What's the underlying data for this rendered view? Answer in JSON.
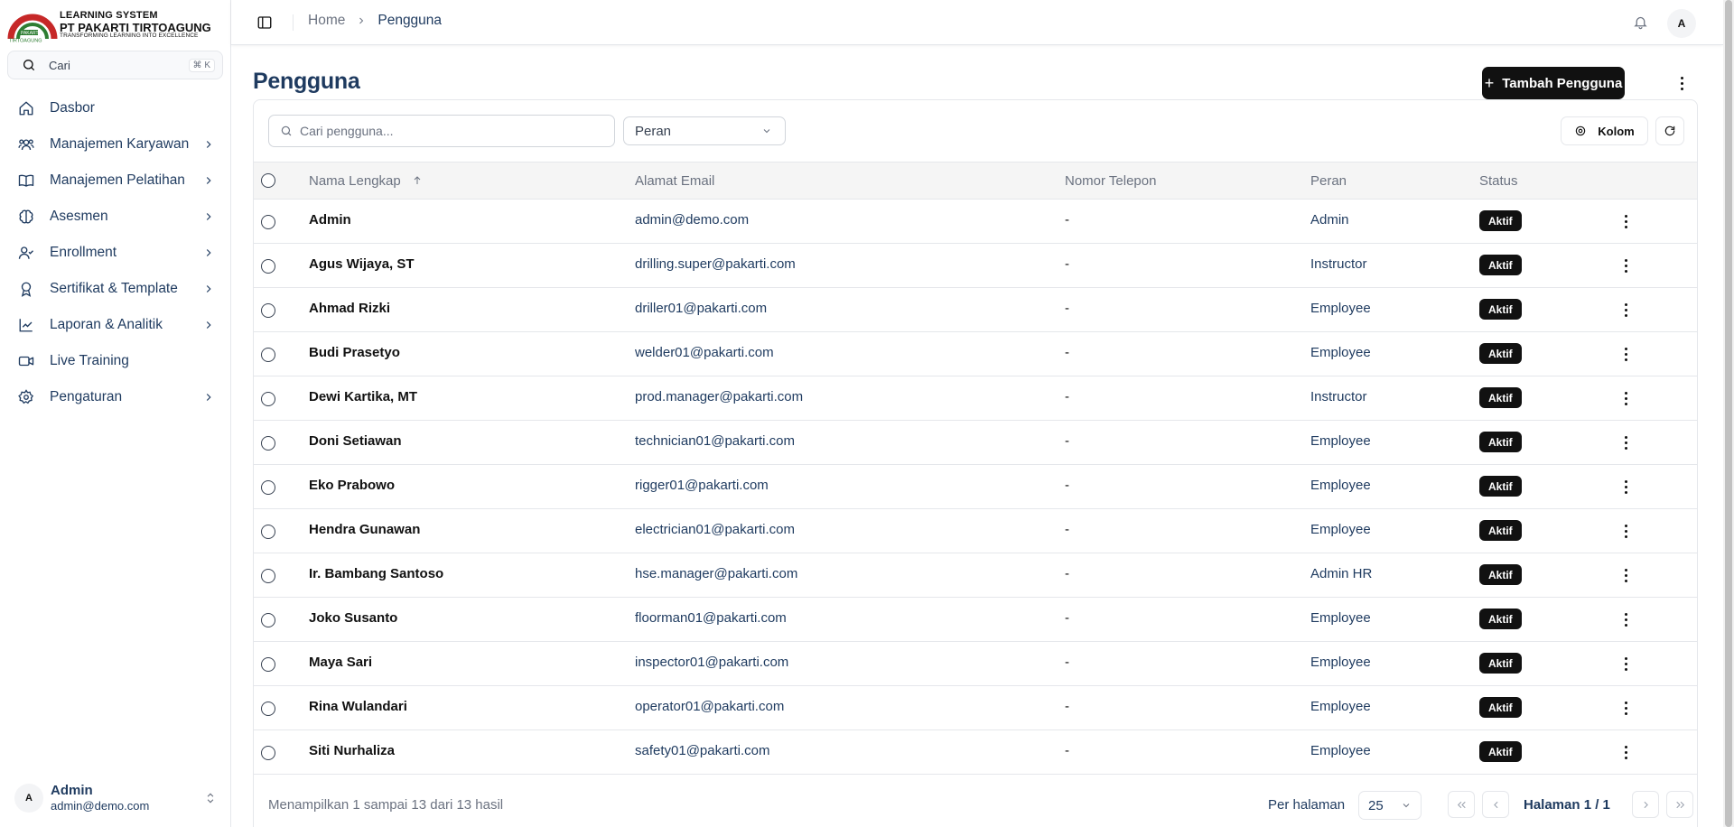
{
  "brand": {
    "line1": "LEARNING SYSTEM",
    "line2": "PT PAKARTI TIRTOAGUNG",
    "line3": "TRANSFORMING LEARNING INTO EXCELLENCE",
    "red": "#c62828",
    "green": "#2e7d32"
  },
  "search": {
    "label": "Cari",
    "shortcut": "⌘ K"
  },
  "sidebar": {
    "items": [
      {
        "label": "Dasbor",
        "icon": "home-icon",
        "expandable": false
      },
      {
        "label": "Manajemen Karyawan",
        "icon": "users-icon",
        "expandable": true
      },
      {
        "label": "Manajemen Pelatihan",
        "icon": "book-icon",
        "expandable": true
      },
      {
        "label": "Asesmen",
        "icon": "brain-icon",
        "expandable": true
      },
      {
        "label": "Enrollment",
        "icon": "user-check-icon",
        "expandable": true
      },
      {
        "label": "Sertifikat & Template",
        "icon": "award-icon",
        "expandable": true
      },
      {
        "label": "Laporan & Analitik",
        "icon": "chart-line-icon",
        "expandable": true
      },
      {
        "label": "Live Training",
        "icon": "video-icon",
        "expandable": false
      },
      {
        "label": "Pengaturan",
        "icon": "gear-icon",
        "expandable": true
      }
    ]
  },
  "user": {
    "initial": "A",
    "name": "Admin",
    "email": "admin@demo.com"
  },
  "header": {
    "breadcrumb": {
      "home": "Home",
      "current": "Pengguna"
    },
    "avatar": "A"
  },
  "page": {
    "title": "Pengguna",
    "add_button": "Tambah Pengguna",
    "search_placeholder": "Cari pengguna...",
    "role_filter": "Peran",
    "columns_button": "Kolom"
  },
  "table": {
    "headers": {
      "name": "Nama Lengkap",
      "email": "Alamat Email",
      "phone": "Nomor Telepon",
      "role": "Peran",
      "status": "Status"
    },
    "rows": [
      {
        "name": "Admin",
        "email": "admin@demo.com",
        "phone": "-",
        "role": "Admin",
        "status": "Aktif"
      },
      {
        "name": "Agus Wijaya, ST",
        "email": "drilling.super@pakarti.com",
        "phone": "-",
        "role": "Instructor",
        "status": "Aktif"
      },
      {
        "name": "Ahmad Rizki",
        "email": "driller01@pakarti.com",
        "phone": "-",
        "role": "Employee",
        "status": "Aktif"
      },
      {
        "name": "Budi Prasetyo",
        "email": "welder01@pakarti.com",
        "phone": "-",
        "role": "Employee",
        "status": "Aktif"
      },
      {
        "name": "Dewi Kartika, MT",
        "email": "prod.manager@pakarti.com",
        "phone": "-",
        "role": "Instructor",
        "status": "Aktif"
      },
      {
        "name": "Doni Setiawan",
        "email": "technician01@pakarti.com",
        "phone": "-",
        "role": "Employee",
        "status": "Aktif"
      },
      {
        "name": "Eko Prabowo",
        "email": "rigger01@pakarti.com",
        "phone": "-",
        "role": "Employee",
        "status": "Aktif"
      },
      {
        "name": "Hendra Gunawan",
        "email": "electrician01@pakarti.com",
        "phone": "-",
        "role": "Employee",
        "status": "Aktif"
      },
      {
        "name": "Ir. Bambang Santoso",
        "email": "hse.manager@pakarti.com",
        "phone": "-",
        "role": "Admin HR",
        "status": "Aktif"
      },
      {
        "name": "Joko Susanto",
        "email": "floorman01@pakarti.com",
        "phone": "-",
        "role": "Employee",
        "status": "Aktif"
      },
      {
        "name": "Maya Sari",
        "email": "inspector01@pakarti.com",
        "phone": "-",
        "role": "Employee",
        "status": "Aktif"
      },
      {
        "name": "Rina Wulandari",
        "email": "operator01@pakarti.com",
        "phone": "-",
        "role": "Employee",
        "status": "Aktif"
      },
      {
        "name": "Siti Nurhaliza",
        "email": "safety01@pakarti.com",
        "phone": "-",
        "role": "Employee",
        "status": "Aktif"
      }
    ]
  },
  "footer": {
    "summary": "Menampilkan 1 sampai 13 dari 13 hasil",
    "per_page_label": "Per halaman",
    "per_page_value": "25",
    "page_label": "Halaman 1 / 1"
  }
}
